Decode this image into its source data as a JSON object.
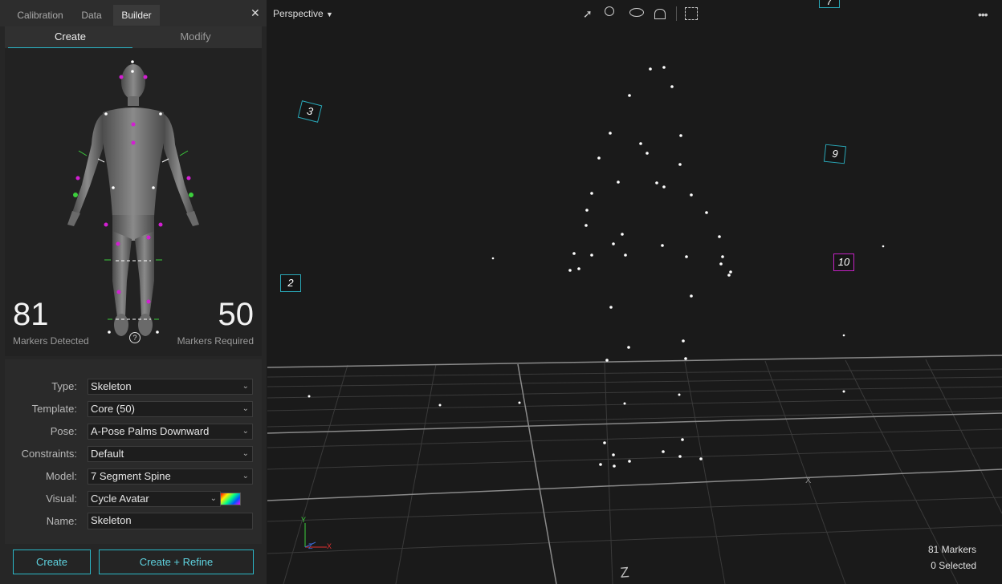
{
  "tabs": [
    "Calibration",
    "Data",
    "Builder"
  ],
  "subtabs": {
    "create": "Create",
    "modify": "Modify"
  },
  "stats": {
    "detected_value": "81",
    "detected_label": "Markers Detected",
    "required_value": "50",
    "required_label": "Markers Required"
  },
  "form": {
    "type_label": "Type:",
    "type_value": "Skeleton",
    "template_label": "Template:",
    "template_value": "Core (50)",
    "pose_label": "Pose:",
    "pose_value": "A-Pose Palms Downward",
    "constraints_label": "Constraints:",
    "constraints_value": "Default",
    "model_label": "Model:",
    "model_value": "7 Segment Spine",
    "visual_label": "Visual:",
    "visual_value": "Cycle Avatar",
    "name_label": "Name:",
    "name_value": "Skeleton"
  },
  "buttons": {
    "create": "Create",
    "create_refine": "Create + Refine"
  },
  "viewport": {
    "view_mode": "Perspective",
    "markers_count": "81 Markers",
    "selected_count": "0 Selected",
    "cameras": [
      "3",
      "9",
      "2",
      "10",
      "7"
    ],
    "axis_labels": [
      "Y",
      "Z",
      "X"
    ]
  },
  "colors": {
    "accent": "#2ab7c9",
    "marker_magenta": "#d21fd2",
    "marker_green": "#3ccf3c"
  },
  "icons": [
    "close-icon",
    "select-arrow-icon",
    "zoom-icon",
    "eye-icon",
    "lock-icon",
    "marquee-icon",
    "more-icon",
    "help-icon",
    "color-swatch-icon"
  ]
}
